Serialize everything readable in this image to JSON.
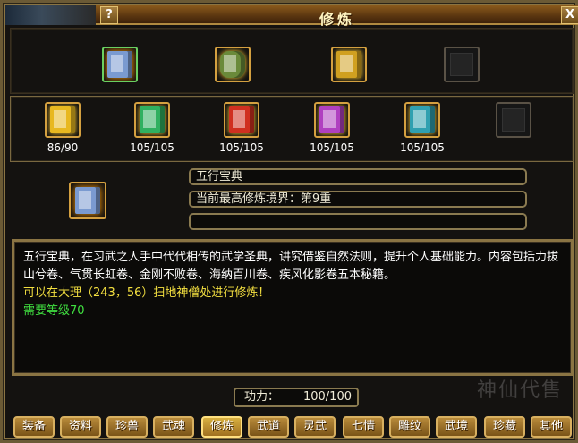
{
  "window": {
    "title": "修炼",
    "help_label": "?",
    "close_label": "X"
  },
  "colors": {
    "frame": "#8a7443",
    "gold_border": "#d4a040",
    "text_yellow": "#f4e040",
    "text_green": "#40e040"
  },
  "row1_slots": [
    {
      "icon": "book-stack-icon",
      "color": "#7a9ad0"
    },
    {
      "icon": "scroll-bundle-icon",
      "color": "#6a8a3a"
    },
    {
      "icon": "gold-treasure-icon",
      "color": "#d0a020"
    },
    {
      "icon": "empty-slot-icon",
      "color": ""
    }
  ],
  "row2_slots": [
    {
      "icon": "yellow-book-icon",
      "color": "#e8b820",
      "count": "86/90"
    },
    {
      "icon": "green-book-icon",
      "color": "#30b060",
      "count": "105/105"
    },
    {
      "icon": "red-book-icon",
      "color": "#d03020",
      "count": "105/105"
    },
    {
      "icon": "purple-book-icon",
      "color": "#b040c0",
      "count": "105/105"
    },
    {
      "icon": "cyan-book-icon",
      "color": "#30a0b0",
      "count": "105/105"
    },
    {
      "icon": "empty-slot-icon",
      "color": "",
      "count": ""
    }
  ],
  "selected": {
    "icon": "book-stack-icon",
    "name": "五行宝典",
    "realm": "当前最高修炼境界：第9重",
    "extra": ""
  },
  "description": {
    "line1": "五行宝典，在习武之人手中代代相传的武学圣典，讲究借鉴自然法则，提升个人基础能力。内容包括力拔山兮卷、气贯长虹卷、金刚不败卷、海纳百川卷、疾风化影卷五本秘籍。",
    "location": "可以在大理（243，56）扫地神僧处进行修炼！",
    "level": "需要等级70"
  },
  "power": {
    "label": "功力：",
    "value": "100/100"
  },
  "tabs": [
    {
      "label": "装备"
    },
    {
      "label": "资料"
    },
    {
      "label": "珍兽"
    },
    {
      "label": "武魂"
    },
    {
      "label": "修炼"
    },
    {
      "label": "武道"
    },
    {
      "label": "灵武"
    },
    {
      "label": "七情"
    },
    {
      "label": "雕纹"
    },
    {
      "label": "武境"
    },
    {
      "label": "珍藏"
    },
    {
      "label": "其他"
    }
  ],
  "active_tab": "修炼",
  "watermark": "神仙代售"
}
